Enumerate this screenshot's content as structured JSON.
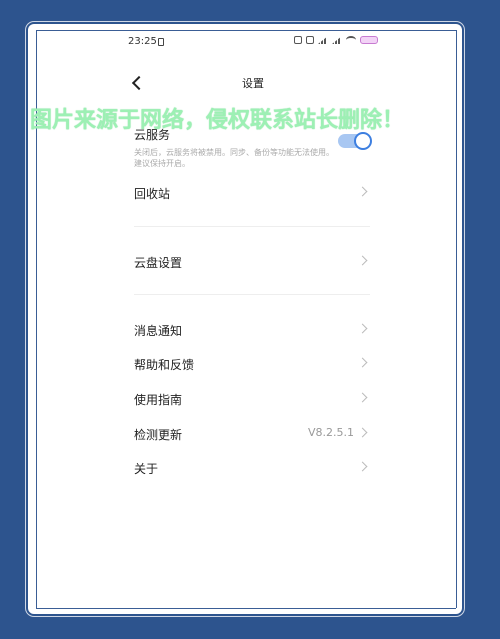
{
  "status_bar": {
    "time": "23:25",
    "icons": [
      "lock-icon",
      "mute-icon",
      "nfc-icon",
      "signal-icon",
      "wifi-icon",
      "battery-icon"
    ]
  },
  "header": {
    "title": "设置"
  },
  "watermark": "图片来源于网络，侵权联系站长删除！",
  "settings": {
    "cloud_service": {
      "label": "云服务",
      "description": "关闭后，云服务将被禁用。同步、备份等功能无法使用。建议保持开启。",
      "enabled": true
    },
    "recycle_bin": {
      "label": "回收站"
    },
    "cloud_disk": {
      "label": "云盘设置"
    },
    "notifications": {
      "label": "消息通知"
    },
    "help_feedback": {
      "label": "帮助和反馈"
    },
    "user_guide": {
      "label": "使用指南"
    },
    "check_update": {
      "label": "检测更新",
      "value": "V8.2.5.1"
    },
    "about": {
      "label": "关于"
    }
  },
  "colors": {
    "frame": "#2d548e",
    "toggle_accent": "#3d7fe0",
    "watermark": "#9df0b4"
  }
}
